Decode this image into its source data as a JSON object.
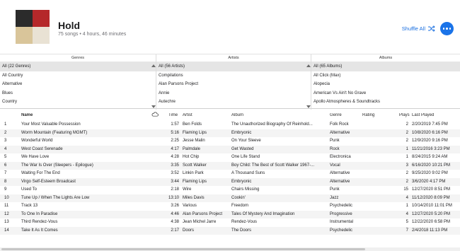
{
  "header": {
    "title": "Hold",
    "subtitle": "75 songs • 4 hours, 46 minutes",
    "shuffle_label": "Shuffle All"
  },
  "colors": {
    "accent": "#1a73e8",
    "art": [
      "#2b2b2b",
      "#b5282a",
      "#d9c59a",
      "#e9e2d4"
    ]
  },
  "browser": {
    "genres": {
      "title": "Genres",
      "items": [
        "All (22 Genres)",
        "All Country",
        "Alternative",
        "Blues",
        "Country"
      ]
    },
    "artists": {
      "title": "Artists",
      "items": [
        "All (56 Artists)",
        "Compilations",
        "Alan Parsons Project",
        "Annie",
        "Autechre"
      ]
    },
    "albums": {
      "title": "Albums",
      "items": [
        "All (65 Albums)",
        "All Click (Max)",
        "Alopecia",
        "American Vs Ain't No Grave",
        "Apollo Atmospheres & Soundtracks"
      ]
    }
  },
  "table": {
    "columns": {
      "name": "Name",
      "time": "Time",
      "artist": "Artist",
      "album": "Album",
      "genre": "Genre",
      "rating": "Rating",
      "plays": "Plays",
      "last_played": "Last Played"
    },
    "rows": [
      {
        "idx": "1",
        "name": "Your Most Valuable Possession",
        "time": "1:57",
        "artist": "Ben Folds",
        "album": "The Unauthorized Biography Of Reinhold...",
        "genre": "Folk Rock",
        "rating": "",
        "plays": "2",
        "last": "2/20/2019 7:45 PM"
      },
      {
        "idx": "2",
        "name": "Worm Mountain (Featuring MGMT)",
        "time": "5:16",
        "artist": "Flaming Lips",
        "album": "Embryonic",
        "genre": "Alternative",
        "rating": "",
        "plays": "2",
        "last": "10/8/2020 6:16 PM"
      },
      {
        "idx": "3",
        "name": "Wonderful World",
        "time": "2:25",
        "artist": "Jesse Malin",
        "album": "On Your Sleeve",
        "genre": "Punk",
        "rating": "",
        "plays": "2",
        "last": "12/9/2020 9:16 PM"
      },
      {
        "idx": "4",
        "name": "West Coast Serenade",
        "time": "4:17",
        "artist": "Palmdale",
        "album": "Get Wasted",
        "genre": "Rock",
        "rating": "",
        "plays": "1",
        "last": "11/21/2016 3:23 PM"
      },
      {
        "idx": "5",
        "name": "We Have Love",
        "time": "4:28",
        "artist": "Hot Chip",
        "album": "One Life Stand",
        "genre": "Electronica",
        "rating": "",
        "plays": "1",
        "last": "8/24/2015 9:24 AM"
      },
      {
        "idx": "6",
        "name": "The War Is Over (Sleepers - Epilogue)",
        "time": "3:35",
        "artist": "Scott Walker",
        "album": "Boy Child: The Best of Scott Walker 1967-...",
        "genre": "Vocal",
        "rating": "",
        "plays": "3",
        "last": "6/16/2020 10:21 PM"
      },
      {
        "idx": "7",
        "name": "Waiting For The End",
        "time": "3:52",
        "artist": "Linkin Park",
        "album": "A Thousand Suns",
        "genre": "Alternative",
        "rating": "",
        "plays": "2",
        "last": "9/25/2020 9:02 PM"
      },
      {
        "idx": "8",
        "name": "Virgo Self-Esteem Broadcast",
        "time": "3:44",
        "artist": "Flaming Lips",
        "album": "Embryonic",
        "genre": "Alternative",
        "rating": "",
        "plays": "2",
        "last": "3/6/2020 4:17 PM"
      },
      {
        "idx": "9",
        "name": "Used To",
        "time": "2:18",
        "artist": "Wire",
        "album": "Chairs Missing",
        "genre": "Punk",
        "rating": "",
        "plays": "15",
        "last": "12/27/2020 8:51 PM"
      },
      {
        "idx": "10",
        "name": "Tune Up / When The Lights Are Low",
        "time": "13:10",
        "artist": "Miles Davis",
        "album": "Cookin'",
        "genre": "Jazz",
        "rating": "",
        "plays": "4",
        "last": "11/12/2020 8:09 PM"
      },
      {
        "idx": "11",
        "name": "Track 13",
        "time": "3:26",
        "artist": "Various",
        "album": "Freedom",
        "genre": "Psychedelic",
        "rating": "",
        "plays": "1",
        "last": "10/14/2010 11:01 PM"
      },
      {
        "idx": "12",
        "name": "To One In Paradise",
        "time": "4:46",
        "artist": "Alan Parsons Project",
        "album": "Tales Of Mystery And Imagination",
        "genre": "Progressive",
        "rating": "",
        "plays": "4",
        "last": "12/27/2020 5:20 PM"
      },
      {
        "idx": "13",
        "name": "Third Rendez-Vous",
        "time": "4:38",
        "artist": "Jean Michel Jarre",
        "album": "Rendez-Vous",
        "genre": "Instrumental",
        "rating": "",
        "plays": "5",
        "last": "12/22/2020 6:58 PM"
      },
      {
        "idx": "14",
        "name": "Take It As It Comes",
        "time": "2:17",
        "artist": "Doors",
        "album": "The Doors",
        "genre": "Psychedelic",
        "rating": "",
        "plays": "7",
        "last": "2/4/2018 11:13 PM"
      }
    ]
  }
}
